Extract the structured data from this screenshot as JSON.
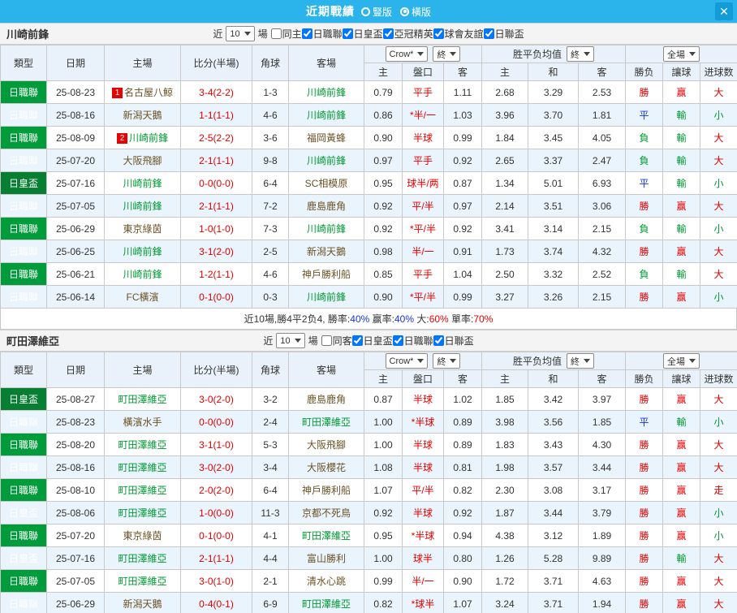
{
  "colors": {
    "accent": "#2ab4eb",
    "win": "#e60000",
    "draw": "#1733e8",
    "lose": "#009933",
    "league_badge": "#009b3a",
    "cup_badge": "#077f33",
    "tracked_team": "#009933"
  },
  "titlebar": {
    "title": "近期戰績",
    "layout_options": [
      {
        "label": "豎版",
        "selected": false
      },
      {
        "label": "橫版",
        "selected": true
      }
    ],
    "close_icon": "✕"
  },
  "filters_shared": {
    "near": "近",
    "games": "10",
    "unit": "場"
  },
  "table_headers": {
    "type": "類型",
    "date": "日期",
    "home": "主場",
    "score": "比分(半場)",
    "corner": "角球",
    "away": "客場",
    "odds_source": "Crow*",
    "final1": "終",
    "avg_title": "胜平负均值",
    "final2": "終",
    "full": "全場",
    "h": "主",
    "handicap": "盤口",
    "a": "客",
    "avg_h": "主",
    "avg_d": "和",
    "avg_a": "客",
    "result": "勝负",
    "let_goal": "讓球",
    "goals": "进球数"
  },
  "sections": [
    {
      "team": "川崎前鋒",
      "checkboxes": [
        {
          "label": "同主",
          "checked": false
        },
        {
          "label": "日職聯",
          "checked": true
        },
        {
          "label": "日皇盃",
          "checked": true
        },
        {
          "label": "亞冠精英",
          "checked": true
        },
        {
          "label": "球會友誼",
          "checked": true
        },
        {
          "label": "日聯盃",
          "checked": true
        }
      ],
      "rows": [
        {
          "type": "日職聯",
          "date": "25-08-23",
          "home": "名古屋八鯨",
          "home_badge": "1",
          "home_team": false,
          "score": "3-4(2-2)",
          "corner": "1-3",
          "away": "川崎前鋒",
          "away_team": true,
          "odds_h": "0.79",
          "handicap": "平手",
          "odds_a": "1.11",
          "avg_h": "2.68",
          "avg_d": "3.29",
          "avg_a": "2.53",
          "result": "勝",
          "let_goal": "赢",
          "goals": "大"
        },
        {
          "type": "日職聯",
          "date": "25-08-16",
          "home": "新潟天鵝",
          "home_team": false,
          "score": "1-1(1-1)",
          "corner": "4-6",
          "away": "川崎前鋒",
          "away_team": true,
          "odds_h": "0.86",
          "handicap": "*半/一",
          "odds_a": "1.03",
          "avg_h": "3.96",
          "avg_d": "3.70",
          "avg_a": "1.81",
          "result": "平",
          "let_goal": "輸",
          "goals": "小"
        },
        {
          "type": "日職聯",
          "date": "25-08-09",
          "home": "川崎前鋒",
          "home_badge": "2",
          "home_team": true,
          "score": "2-5(2-2)",
          "corner": "3-6",
          "away": "福岡黃蜂",
          "away_team": false,
          "odds_h": "0.90",
          "handicap": "半球",
          "odds_a": "0.99",
          "avg_h": "1.84",
          "avg_d": "3.45",
          "avg_a": "4.05",
          "result": "負",
          "let_goal": "輸",
          "goals": "大"
        },
        {
          "type": "日職聯",
          "date": "25-07-20",
          "home": "大阪飛腳",
          "home_team": false,
          "score": "2-1(1-1)",
          "corner": "9-8",
          "away": "川崎前鋒",
          "away_team": true,
          "odds_h": "0.97",
          "handicap": "平手",
          "odds_a": "0.92",
          "avg_h": "2.65",
          "avg_d": "3.37",
          "avg_a": "2.47",
          "result": "負",
          "let_goal": "輸",
          "goals": "大"
        },
        {
          "type": "日皇盃",
          "date": "25-07-16",
          "home": "川崎前鋒",
          "home_team": true,
          "score": "0-0(0-0)",
          "corner": "6-4",
          "away": "SC相模原",
          "away_team": false,
          "odds_h": "0.95",
          "handicap": "球半/两",
          "odds_a": "0.87",
          "avg_h": "1.34",
          "avg_d": "5.01",
          "avg_a": "6.93",
          "result": "平",
          "let_goal": "輸",
          "goals": "小"
        },
        {
          "type": "日職聯",
          "date": "25-07-05",
          "home": "川崎前鋒",
          "home_team": true,
          "score": "2-1(1-1)",
          "corner": "7-2",
          "away": "鹿島鹿角",
          "away_team": false,
          "odds_h": "0.92",
          "handicap": "平/半",
          "odds_a": "0.97",
          "avg_h": "2.14",
          "avg_d": "3.51",
          "avg_a": "3.06",
          "result": "勝",
          "let_goal": "赢",
          "goals": "大"
        },
        {
          "type": "日職聯",
          "date": "25-06-29",
          "home": "東京綠茵",
          "home_team": false,
          "score": "1-0(1-0)",
          "corner": "7-3",
          "away": "川崎前鋒",
          "away_team": true,
          "odds_h": "0.92",
          "handicap": "*平/半",
          "odds_a": "0.92",
          "avg_h": "3.41",
          "avg_d": "3.14",
          "avg_a": "2.15",
          "result": "負",
          "let_goal": "輸",
          "goals": "小"
        },
        {
          "type": "日職聯",
          "date": "25-06-25",
          "home": "川崎前鋒",
          "home_team": true,
          "score": "3-1(2-0)",
          "corner": "2-5",
          "away": "新潟天鵝",
          "away_team": false,
          "odds_h": "0.98",
          "handicap": "半/一",
          "odds_a": "0.91",
          "avg_h": "1.73",
          "avg_d": "3.74",
          "avg_a": "4.32",
          "result": "勝",
          "let_goal": "赢",
          "goals": "大"
        },
        {
          "type": "日職聯",
          "date": "25-06-21",
          "home": "川崎前鋒",
          "home_team": true,
          "score": "1-2(1-1)",
          "corner": "4-6",
          "away": "神戶勝利船",
          "away_team": false,
          "odds_h": "0.85",
          "handicap": "平手",
          "odds_a": "1.04",
          "avg_h": "2.50",
          "avg_d": "3.32",
          "avg_a": "2.52",
          "result": "負",
          "let_goal": "輸",
          "goals": "大"
        },
        {
          "type": "日職聯",
          "date": "25-06-14",
          "home": "FC橫濱",
          "home_team": false,
          "score": "0-1(0-0)",
          "corner": "0-3",
          "away": "川崎前鋒",
          "away_team": true,
          "odds_h": "0.90",
          "handicap": "*平/半",
          "odds_a": "0.99",
          "avg_h": "3.27",
          "avg_d": "3.26",
          "avg_a": "2.15",
          "result": "勝",
          "let_goal": "赢",
          "goals": "小"
        }
      ],
      "summary": [
        {
          "text": "近10場,勝4平2负4, 勝率:",
          "c": "n"
        },
        {
          "text": "40%",
          "c": "b"
        },
        {
          "text": " 赢率:",
          "c": "n"
        },
        {
          "text": "40%",
          "c": "b"
        },
        {
          "text": " 大:",
          "c": "n"
        },
        {
          "text": "60%",
          "c": "r"
        },
        {
          "text": " 單率:",
          "c": "n"
        },
        {
          "text": "70%",
          "c": "r"
        }
      ]
    },
    {
      "team": "町田澤維亞",
      "checkboxes": [
        {
          "label": "同客",
          "checked": false
        },
        {
          "label": "日皇盃",
          "checked": true
        },
        {
          "label": "日職聯",
          "checked": true
        },
        {
          "label": "日聯盃",
          "checked": true
        }
      ],
      "rows": [
        {
          "type": "日皇盃",
          "date": "25-08-27",
          "home": "町田澤維亞",
          "home_team": true,
          "score": "3-0(2-0)",
          "corner": "3-2",
          "away": "鹿島鹿角",
          "away_team": false,
          "odds_h": "0.87",
          "handicap": "半球",
          "odds_a": "1.02",
          "avg_h": "1.85",
          "avg_d": "3.42",
          "avg_a": "3.97",
          "result": "勝",
          "let_goal": "赢",
          "goals": "大"
        },
        {
          "type": "日職聯",
          "date": "25-08-23",
          "home": "橫濱水手",
          "home_team": false,
          "score": "0-0(0-0)",
          "corner": "2-4",
          "away": "町田澤維亞",
          "away_team": true,
          "odds_h": "1.00",
          "handicap": "*半球",
          "odds_a": "0.89",
          "avg_h": "3.98",
          "avg_d": "3.56",
          "avg_a": "1.85",
          "result": "平",
          "let_goal": "輸",
          "goals": "小"
        },
        {
          "type": "日職聯",
          "date": "25-08-20",
          "home": "町田澤維亞",
          "home_team": true,
          "score": "3-1(1-0)",
          "corner": "5-3",
          "away": "大阪飛腳",
          "away_team": false,
          "odds_h": "1.00",
          "handicap": "半球",
          "odds_a": "0.89",
          "avg_h": "1.83",
          "avg_d": "3.43",
          "avg_a": "4.30",
          "result": "勝",
          "let_goal": "赢",
          "goals": "大"
        },
        {
          "type": "日職聯",
          "date": "25-08-16",
          "home": "町田澤維亞",
          "home_team": true,
          "score": "3-0(2-0)",
          "corner": "3-4",
          "away": "大阪櫻花",
          "away_team": false,
          "odds_h": "1.08",
          "handicap": "半球",
          "odds_a": "0.81",
          "avg_h": "1.98",
          "avg_d": "3.57",
          "avg_a": "3.44",
          "result": "勝",
          "let_goal": "赢",
          "goals": "大"
        },
        {
          "type": "日職聯",
          "date": "25-08-10",
          "home": "町田澤維亞",
          "home_team": true,
          "score": "2-0(2-0)",
          "corner": "6-4",
          "away": "神戶勝利船",
          "away_team": false,
          "odds_h": "1.07",
          "handicap": "平/半",
          "odds_a": "0.82",
          "avg_h": "2.30",
          "avg_d": "3.08",
          "avg_a": "3.17",
          "result": "勝",
          "let_goal": "赢",
          "goals": "走"
        },
        {
          "type": "日皇盃",
          "date": "25-08-06",
          "home": "町田澤維亞",
          "home_team": true,
          "score": "1-0(0-0)",
          "corner": "11-3",
          "away": "京都不死鳥",
          "away_team": false,
          "odds_h": "0.92",
          "handicap": "半球",
          "odds_a": "0.92",
          "avg_h": "1.87",
          "avg_d": "3.44",
          "avg_a": "3.79",
          "result": "勝",
          "let_goal": "赢",
          "goals": "小"
        },
        {
          "type": "日職聯",
          "date": "25-07-20",
          "home": "東京綠茵",
          "home_team": false,
          "score": "0-1(0-0)",
          "corner": "4-1",
          "away": "町田澤維亞",
          "away_team": true,
          "odds_h": "0.95",
          "handicap": "*半球",
          "odds_a": "0.94",
          "avg_h": "4.38",
          "avg_d": "3.12",
          "avg_a": "1.89",
          "result": "勝",
          "let_goal": "赢",
          "goals": "小"
        },
        {
          "type": "日皇盃",
          "date": "25-07-16",
          "home": "町田澤維亞",
          "home_team": true,
          "score": "2-1(1-1)",
          "corner": "4-4",
          "away": "富山勝利",
          "away_team": false,
          "odds_h": "1.00",
          "handicap": "球半",
          "odds_a": "0.80",
          "avg_h": "1.26",
          "avg_d": "5.28",
          "avg_a": "9.89",
          "result": "勝",
          "let_goal": "輸",
          "goals": "大"
        },
        {
          "type": "日職聯",
          "date": "25-07-05",
          "home": "町田澤維亞",
          "home_team": true,
          "score": "3-0(1-0)",
          "corner": "2-1",
          "away": "清水心跳",
          "away_team": false,
          "odds_h": "0.99",
          "handicap": "半/一",
          "odds_a": "0.90",
          "avg_h": "1.72",
          "avg_d": "3.71",
          "avg_a": "4.63",
          "result": "勝",
          "let_goal": "赢",
          "goals": "大"
        },
        {
          "type": "日職聯",
          "date": "25-06-29",
          "home": "新潟天鵝",
          "home_team": false,
          "score": "0-4(0-1)",
          "corner": "6-9",
          "away": "町田澤維亞",
          "away_team": true,
          "odds_h": "0.82",
          "handicap": "*球半",
          "odds_a": "1.07",
          "avg_h": "3.24",
          "avg_d": "3.71",
          "avg_a": "1.94",
          "result": "勝",
          "let_goal": "赢",
          "goals": "大"
        }
      ],
      "summary": null
    }
  ]
}
